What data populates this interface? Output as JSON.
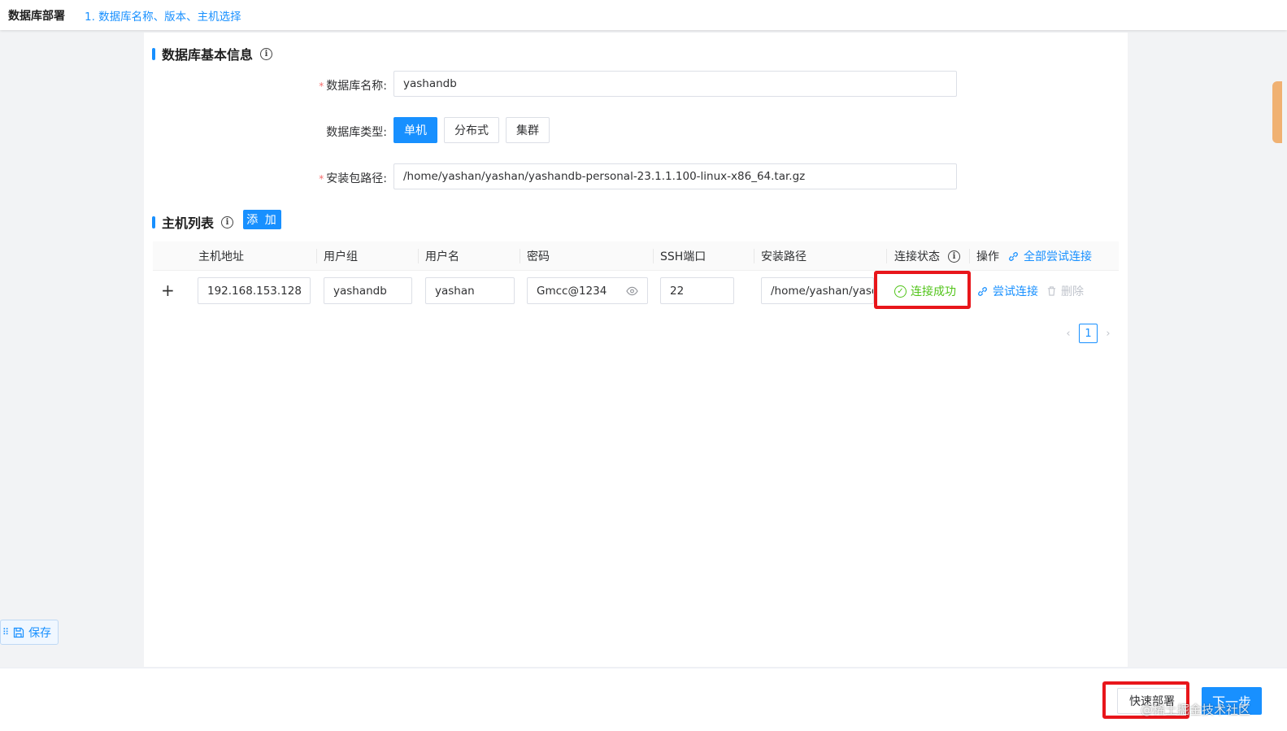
{
  "header": {
    "title": "数据库部署",
    "step": "1. 数据库名称、版本、主机选择"
  },
  "basic_info": {
    "title": "数据库基本信息",
    "name_label": "数据库名称:",
    "name_value": "yashandb",
    "type_label": "数据库类型:",
    "types": [
      "单机",
      "分布式",
      "集群"
    ],
    "selected_type": "单机",
    "path_label": "安装包路径:",
    "path_value": "/home/yashan/yashan/yashandb-personal-23.1.1.100-linux-x86_64.tar.gz"
  },
  "host_list": {
    "title": "主机列表",
    "add_label": "添 加",
    "columns": [
      "主机地址",
      "用户组",
      "用户名",
      "密码",
      "SSH端口",
      "安装路径",
      "连接状态",
      "操作"
    ],
    "try_all_label": "全部尝试连接",
    "rows": [
      {
        "host": "192.168.153.128",
        "group": "yashandb",
        "user": "yashan",
        "password": "Gmcc@1234",
        "port": "22",
        "path": "/home/yashan/yasd",
        "status": "连接成功",
        "try_label": "尝试连接",
        "delete_label": "删除"
      }
    ],
    "pagination": {
      "current": "1"
    }
  },
  "save_label": "保存",
  "footer": {
    "quick_deploy_label": "快速部署",
    "next_label": "下一步",
    "watermark": "@稀土掘金技术社区"
  },
  "colors": {
    "primary": "#1890ff",
    "success": "#52c41a",
    "highlight": "#e8161b"
  }
}
